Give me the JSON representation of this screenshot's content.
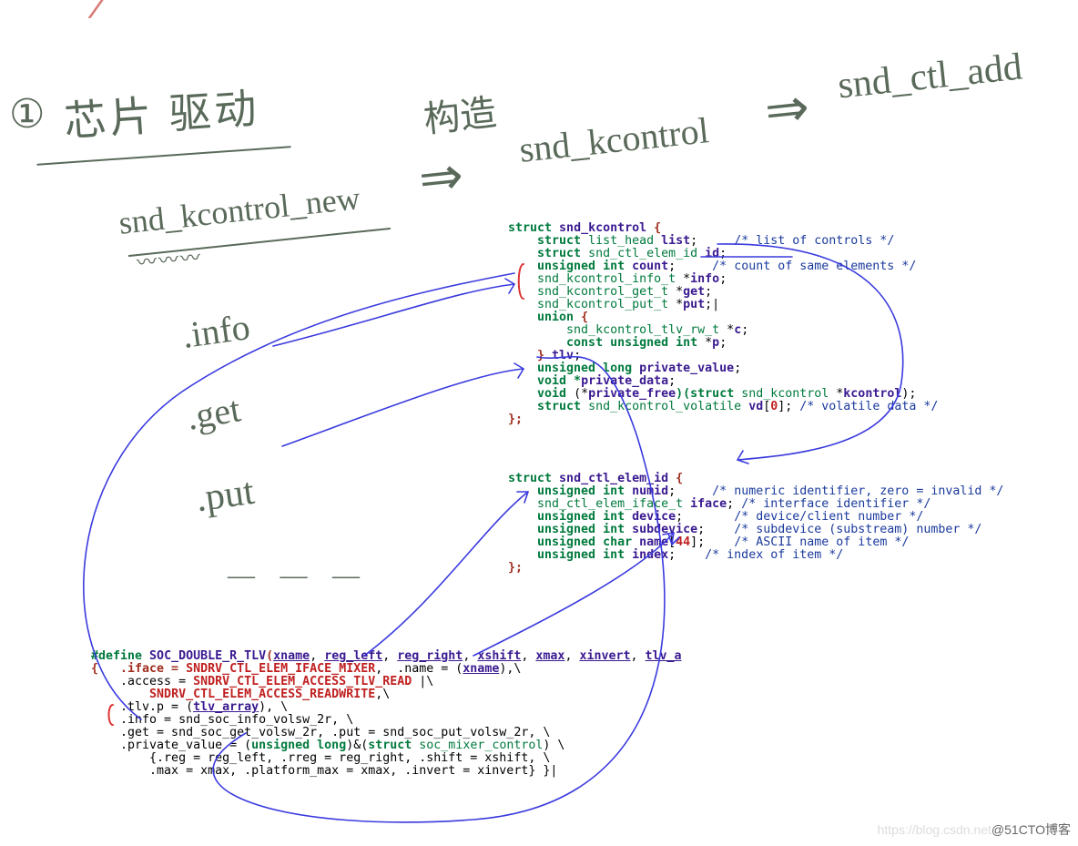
{
  "handwriting": {
    "topRedPartial": "",
    "leftCircle": "①",
    "leftTitle": "芯片 驱动",
    "snd_kcontrol_new": "snd_kcontrol_new",
    "center_label": "构造",
    "arrow1": "⇒",
    "snd_kcontrol": "snd_kcontrol",
    "arrow2": "⇒",
    "snd_ctl_add": "snd_ctl_add",
    "info": ".info",
    "get": ".get",
    "put": ".put",
    "dots": "— — —"
  },
  "struct1": {
    "l1a": "struct",
    "l1b": " snd_kcontrol ",
    "l1c": "{",
    "l2a": "    struct",
    "l2b": " list_head ",
    "l2c": "list",
    "l2d": ";     ",
    "l2e": "/* list of controls */",
    "l3a": "    struct",
    "l3b": " snd_ctl_elem_id ",
    "l3c": "id",
    "l3d": ";",
    "l4a": "    unsigned int ",
    "l4b": "count",
    "l4c": ";     ",
    "l4d": "/* count of same elements */",
    "l5a": "    snd_kcontrol_info_t ",
    "l5b": "*",
    "l5c": "info",
    "l5d": ";",
    "l6a": "    snd_kcontrol_get_t ",
    "l6b": "*",
    "l6c": "get",
    "l6d": ";",
    "l7a": "    snd_kcontrol_put_t ",
    "l7b": "*",
    "l7c": "put",
    "l7d": ";|",
    "l8a": "    union ",
    "l8b": "{",
    "l9a": "        snd_kcontrol_tlv_rw_t ",
    "l9b": "*",
    "l9c": "c",
    "l9d": ";",
    "l10a": "        const unsigned int ",
    "l10b": "*",
    "l10c": "p",
    "l10d": ";",
    "l11a": "    } ",
    "l11b": "tlv",
    "l11c": ";",
    "l12a": "    unsigned long ",
    "l12b": "private_value",
    "l12c": ";",
    "l13a": "    void *",
    "l13b": "private_data",
    "l13c": ";",
    "l14a": "    void ",
    "l14b": "(*",
    "l14c": "private_free",
    "l14d": ")(struct",
    "l14e": " snd_kcontrol ",
    "l14f": "*",
    "l14g": "kcontrol",
    "l14h": ");",
    "l15a": "    struct ",
    "l15b": "snd_kcontrol_volatile ",
    "l15c": "vd",
    "l15d": "[",
    "l15e": "0",
    "l15f": "]; ",
    "l15g": "/* volatile data */",
    "l16": "};"
  },
  "struct2": {
    "l1a": "struct",
    "l1b": " snd_ctl_elem_id ",
    "l1c": "{",
    "l2a": "    unsigned int ",
    "l2b": "numid",
    "l2c": ";     ",
    "l2d": "/* numeric identifier, zero = invalid */",
    "l3a": "    snd_ctl_elem_iface_t ",
    "l3b": "iface",
    "l3c": "; ",
    "l3d": "/* interface identifier */",
    "l4a": "    unsigned int ",
    "l4b": "device",
    "l4c": ";       ",
    "l4d": "/* device/client number */",
    "l5a": "    unsigned int ",
    "l5b": "subdevice",
    "l5c": ";    ",
    "l5d": "/* subdevice (substream) number */",
    "l6a": "    unsigned char ",
    "l6b": "name",
    "l6c": "[",
    "l6d": "44",
    "l6e": "];    ",
    "l6f": "/* ASCII name of item */",
    "l7a": "    unsigned int ",
    "l7b": "index",
    "l7c": ";    ",
    "l7d": "/* index of item */",
    "l8": "};"
  },
  "macro": {
    "l1a": "#define",
    "l1b": " SOC_DOUBLE_R_TLV",
    "l1c": "(",
    "l1d": "xname",
    "l1e": ", ",
    "l1f": "reg_left",
    "l1g": ", ",
    "l1h": "reg_right",
    "l1i": ", ",
    "l1j": "xshift",
    "l1k": ", ",
    "l1l": "xmax",
    "l1m": ", ",
    "l1n": "xinvert",
    "l1o": ", ",
    "l1p": "tlv_a",
    "l2a": "{   .iface = ",
    "l2b": "SNDRV_CTL_ELEM_IFACE_MIXER",
    "l2c": ",  .name = (",
    "l2d": "xname",
    "l2e": "),\\",
    "l3a": "    .access = ",
    "l3b": "SNDRV_CTL_ELEM_ACCESS_TLV_READ",
    "l3c": " |\\",
    "l4a": "        ",
    "l4b": "SNDRV_CTL_ELEM_ACCESS_READWRITE",
    "l4c": ",\\",
    "l5a": "    .tlv.p = (",
    "l5b": "tlv_array",
    "l5c": "), \\",
    "l6": "    .info = snd_soc_info_volsw_2r, \\",
    "l7": "    .get = snd_soc_get_volsw_2r, .put = snd_soc_put_volsw_2r, \\",
    "l8a": "    .private_value = (",
    "l8b": "unsigned long",
    "l8c": ")&(",
    "l8d": "struct",
    "l8e": " soc_mixer_control",
    "l8f": ") \\",
    "l9": "        {.reg = reg_left, .rreg = reg_right, .shift = xshift, \\",
    "l10": "        .max = xmax, .platform_max = xmax, .invert = xinvert} }|"
  },
  "watermark": {
    "left": "https://blog.csdn.net",
    "right": "@51CTO博客"
  }
}
